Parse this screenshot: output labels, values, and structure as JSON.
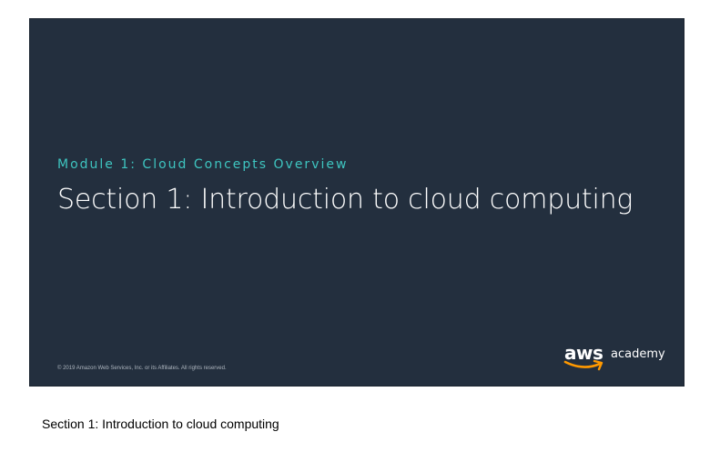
{
  "slide": {
    "module_label": "Module 1: Cloud Concepts Overview",
    "title": "Section 1: Introduction to cloud computing",
    "copyright": "© 2019 Amazon Web Services, Inc. or its Affiliates. All rights reserved.",
    "logo": {
      "brand": "aws",
      "product": "academy",
      "smile_color": "#ff9900"
    },
    "background_color": "#232f3e",
    "accent_color": "#3ec5c0"
  },
  "caption": "Section 1: Introduction to cloud computing"
}
